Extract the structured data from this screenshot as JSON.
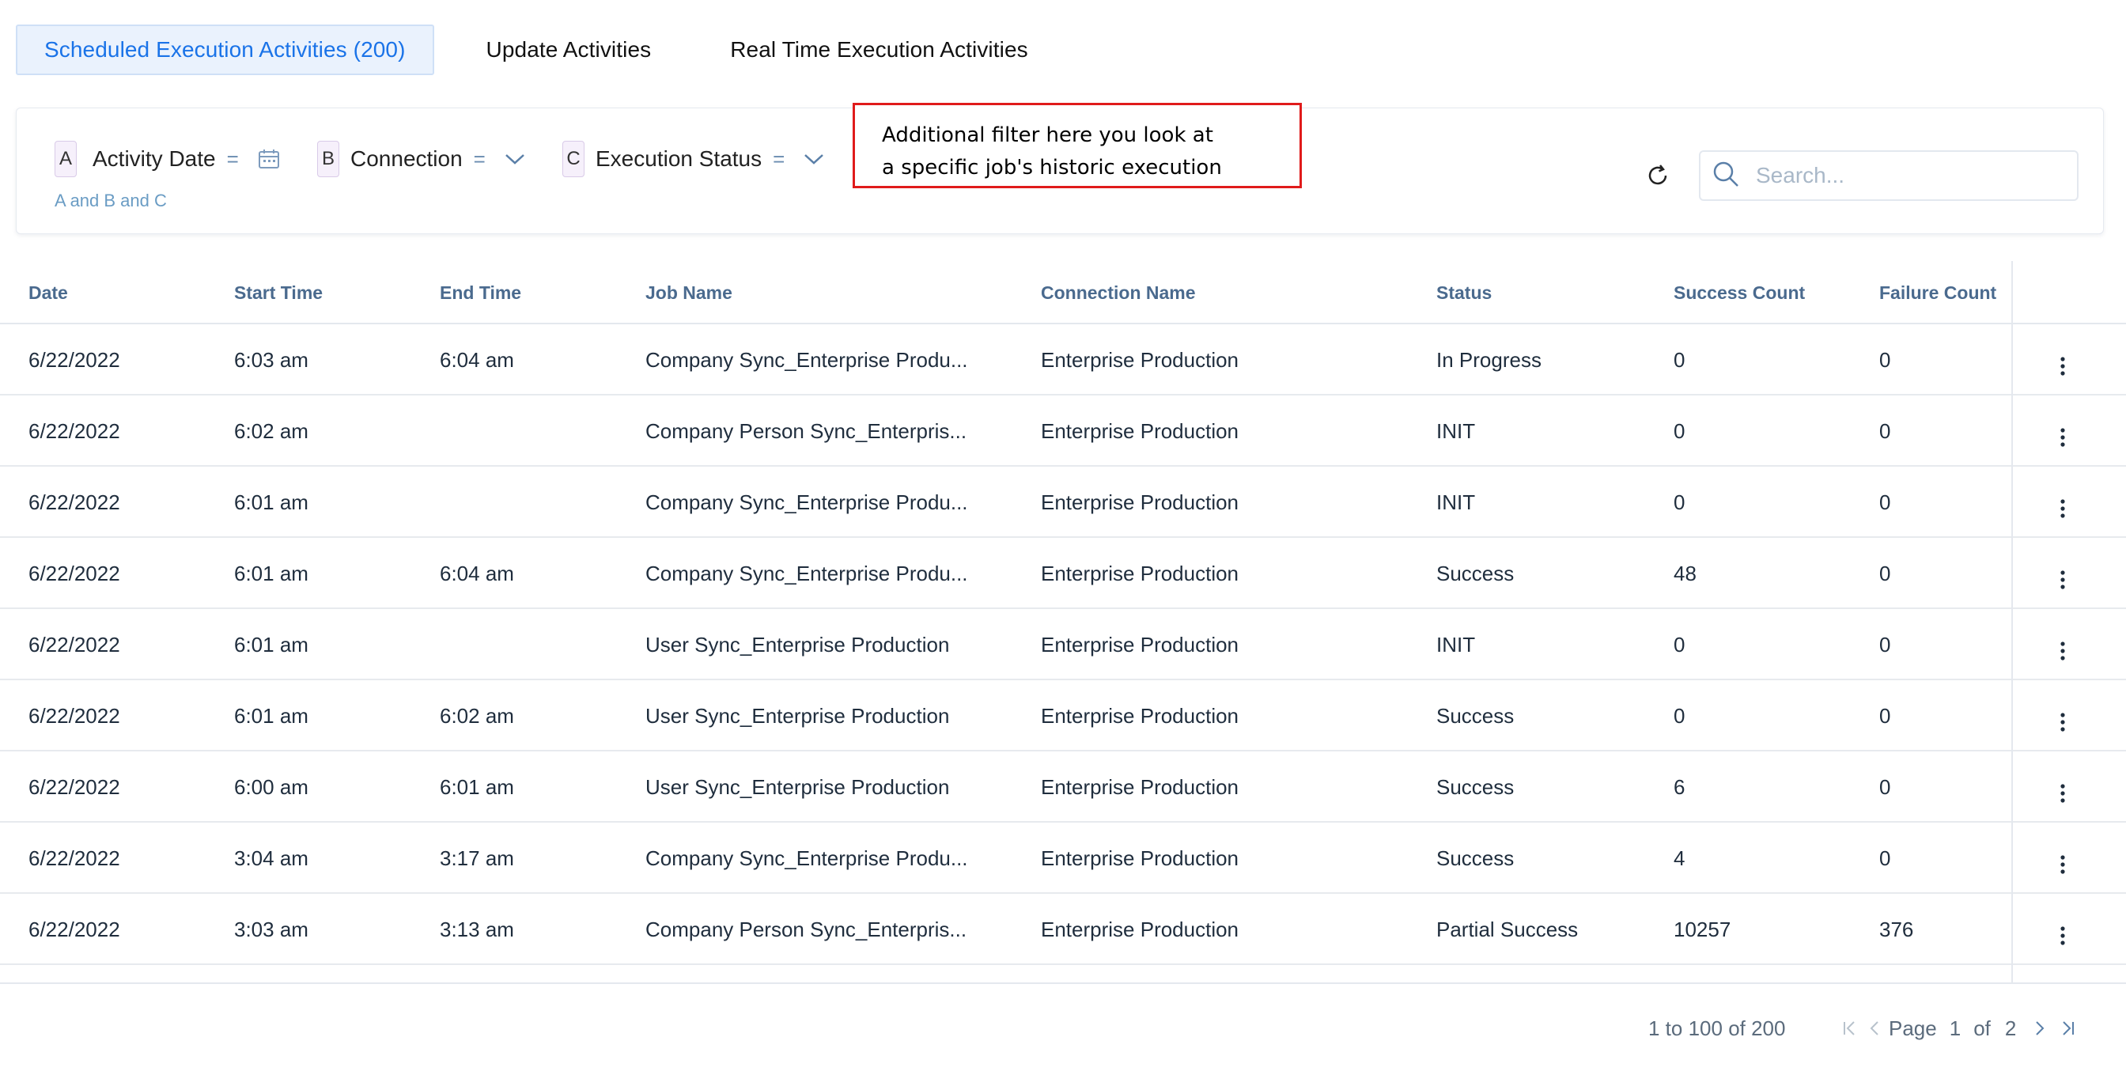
{
  "tabs": [
    {
      "label": "Scheduled Execution Activities (200)",
      "active": true
    },
    {
      "label": "Update Activities",
      "active": false
    },
    {
      "label": "Real Time Execution Activities",
      "active": false
    }
  ],
  "filters": {
    "chips": [
      {
        "letter": "A",
        "label": "Activity Date",
        "op": "=",
        "icon": "calendar-icon"
      },
      {
        "letter": "B",
        "label": "Connection",
        "op": "=",
        "icon": "chevron-down-icon"
      },
      {
        "letter": "C",
        "label": "Execution Status",
        "op": "=",
        "icon": "chevron-down-icon"
      }
    ],
    "logic": "A and B and C",
    "search_placeholder": "Search..."
  },
  "annotation": {
    "line1": "Additional filter here you look at",
    "line2": "a specific job's historic execution"
  },
  "table": {
    "columns": [
      "Date",
      "Start Time",
      "End Time",
      "Job Name",
      "Connection Name",
      "Status",
      "Success Count",
      "Failure Count"
    ],
    "rows": [
      [
        "6/22/2022",
        "6:03 am",
        "6:04 am",
        "Company Sync_Enterprise Produ...",
        "Enterprise Production",
        "In Progress",
        "0",
        "0"
      ],
      [
        "6/22/2022",
        "6:02 am",
        "",
        "Company Person Sync_Enterpris...",
        "Enterprise Production",
        "INIT",
        "0",
        "0"
      ],
      [
        "6/22/2022",
        "6:01 am",
        "",
        "Company Sync_Enterprise Produ...",
        "Enterprise Production",
        "INIT",
        "0",
        "0"
      ],
      [
        "6/22/2022",
        "6:01 am",
        "6:04 am",
        "Company Sync_Enterprise Produ...",
        "Enterprise Production",
        "Success",
        "48",
        "0"
      ],
      [
        "6/22/2022",
        "6:01 am",
        "",
        "User Sync_Enterprise Production",
        "Enterprise Production",
        "INIT",
        "0",
        "0"
      ],
      [
        "6/22/2022",
        "6:01 am",
        "6:02 am",
        "User Sync_Enterprise Production",
        "Enterprise Production",
        "Success",
        "0",
        "0"
      ],
      [
        "6/22/2022",
        "6:00 am",
        "6:01 am",
        "User Sync_Enterprise Production",
        "Enterprise Production",
        "Success",
        "6",
        "0"
      ],
      [
        "6/22/2022",
        "3:04 am",
        "3:17 am",
        "Company Sync_Enterprise Produ...",
        "Enterprise Production",
        "Success",
        "4",
        "0"
      ],
      [
        "6/22/2022",
        "3:03 am",
        "3:13 am",
        "Company Person Sync_Enterpris...",
        "Enterprise Production",
        "Partial Success",
        "10257",
        "376"
      ]
    ]
  },
  "pagination": {
    "range": "1 to 100 of 200",
    "page_label": "Page",
    "page": "1",
    "of_label": "of",
    "total": "2"
  },
  "colors": {
    "accent": "#1a73e8",
    "annotation_border": "#e01b1b",
    "header_text": "#4a6a8e"
  }
}
